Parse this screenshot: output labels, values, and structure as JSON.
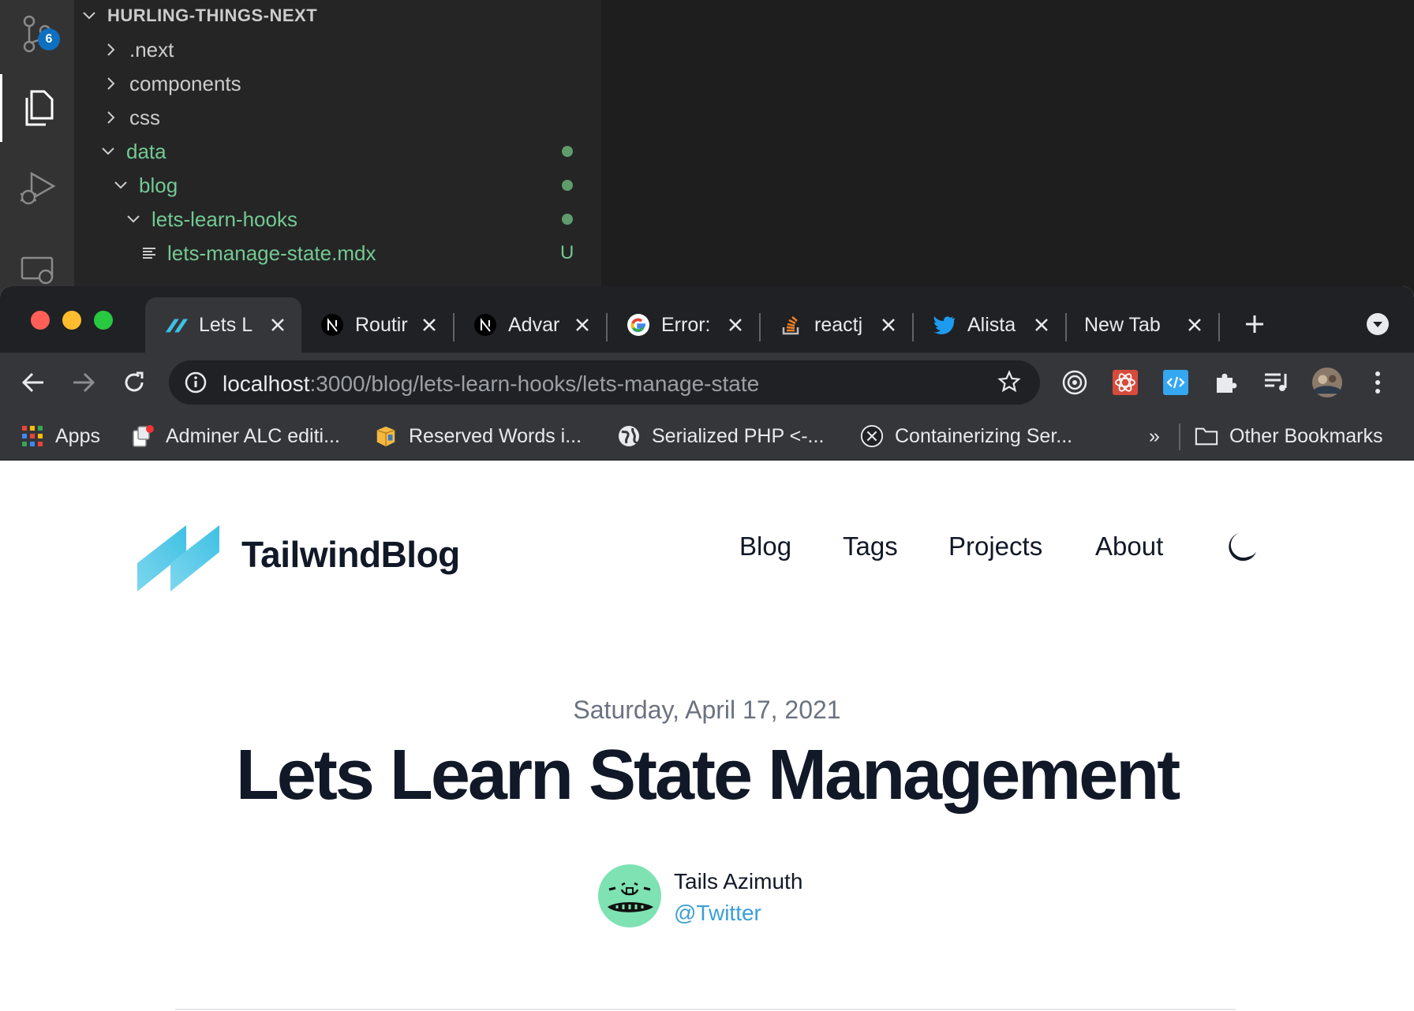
{
  "vscode": {
    "scm_badge": "6",
    "explorer": {
      "root": "HURLING-THINGS-NEXT",
      "items": [
        {
          "label": ".next",
          "status": ""
        },
        {
          "label": "components",
          "status": ""
        },
        {
          "label": "css",
          "status": ""
        },
        {
          "label": "data",
          "status": "dot"
        },
        {
          "label": "blog",
          "status": "dot"
        },
        {
          "label": "lets-learn-hooks",
          "status": "dot"
        },
        {
          "label": "lets-manage-state.mdx",
          "status": "U"
        }
      ]
    }
  },
  "browser": {
    "tabs": [
      {
        "label": "Lets L",
        "icon": "tailwind-icon",
        "active": true
      },
      {
        "label": "Routir",
        "icon": "nextjs-icon"
      },
      {
        "label": "Advar",
        "icon": "nextjs-icon"
      },
      {
        "label": "Error:",
        "icon": "google-icon"
      },
      {
        "label": "reactj",
        "icon": "stackoverflow-icon"
      },
      {
        "label": "Alista",
        "icon": "twitter-icon"
      },
      {
        "label": "New Tab",
        "icon": ""
      }
    ],
    "address": {
      "host": "localhost",
      "path": ":3000/blog/lets-learn-hooks/lets-manage-state"
    },
    "bookmarks": [
      {
        "label": "Apps",
        "icon": "apps-grid-icon"
      },
      {
        "label": "Adminer ALC editi...",
        "icon": "adminer-icon"
      },
      {
        "label": "Reserved Words i...",
        "icon": "box-icon"
      },
      {
        "label": "Serialized PHP <-...",
        "icon": "globe-icon"
      },
      {
        "label": "Containerizing Ser...",
        "icon": "circle-x-icon"
      }
    ],
    "bookmarks_overflow": "»",
    "other_bookmarks": "Other Bookmarks"
  },
  "site": {
    "title": "TailwindBlog",
    "nav": [
      "Blog",
      "Tags",
      "Projects",
      "About"
    ],
    "post": {
      "date": "Saturday, April 17, 2021",
      "title": "Lets Learn State Management",
      "author_name": "Tails Azimuth",
      "author_handle": "@Twitter"
    }
  },
  "colors": {
    "accent_teal": "#3fc0e4",
    "git_green": "#73c991",
    "link_blue": "#3b9fd6"
  }
}
